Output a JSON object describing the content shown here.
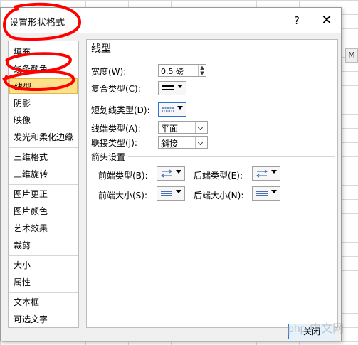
{
  "background": {
    "column_letter": "M"
  },
  "dialog": {
    "title": "设置形状格式",
    "help_label": "?",
    "close_label": "✕",
    "close_button_label": "关闭"
  },
  "nav": {
    "items": [
      {
        "label": "填充"
      },
      {
        "label": "线条颜色"
      },
      {
        "label": "线型",
        "selected": true
      },
      {
        "label": "阴影"
      },
      {
        "label": "映像"
      },
      {
        "label": "发光和柔化边缘"
      },
      {
        "label": "三维格式"
      },
      {
        "label": "三维旋转"
      },
      {
        "label": "图片更正"
      },
      {
        "label": "图片颜色"
      },
      {
        "label": "艺术效果"
      },
      {
        "label": "裁剪"
      },
      {
        "label": "大小"
      },
      {
        "label": "属性"
      },
      {
        "label": "文本框"
      },
      {
        "label": "可选文字"
      }
    ]
  },
  "panel": {
    "title": "线型",
    "width_label": "宽度(W):",
    "width_value": "0.5 磅",
    "compound_label": "复合类型(C):",
    "dash_label": "短划线类型(D):",
    "cap_label": "线端类型(A):",
    "cap_value": "平面",
    "join_label": "联接类型(J):",
    "join_value": "斜接",
    "arrow_section": "箭头设置",
    "begin_type_label": "前端类型(B):",
    "end_type_label": "后端类型(E):",
    "begin_size_label": "前端大小(S):",
    "end_size_label": "后端大小(N):"
  },
  "watermark": "php 中文网",
  "colors": {
    "selected": "#fde08a",
    "focus": "#2b78d4",
    "annotation": "#ff0000"
  }
}
